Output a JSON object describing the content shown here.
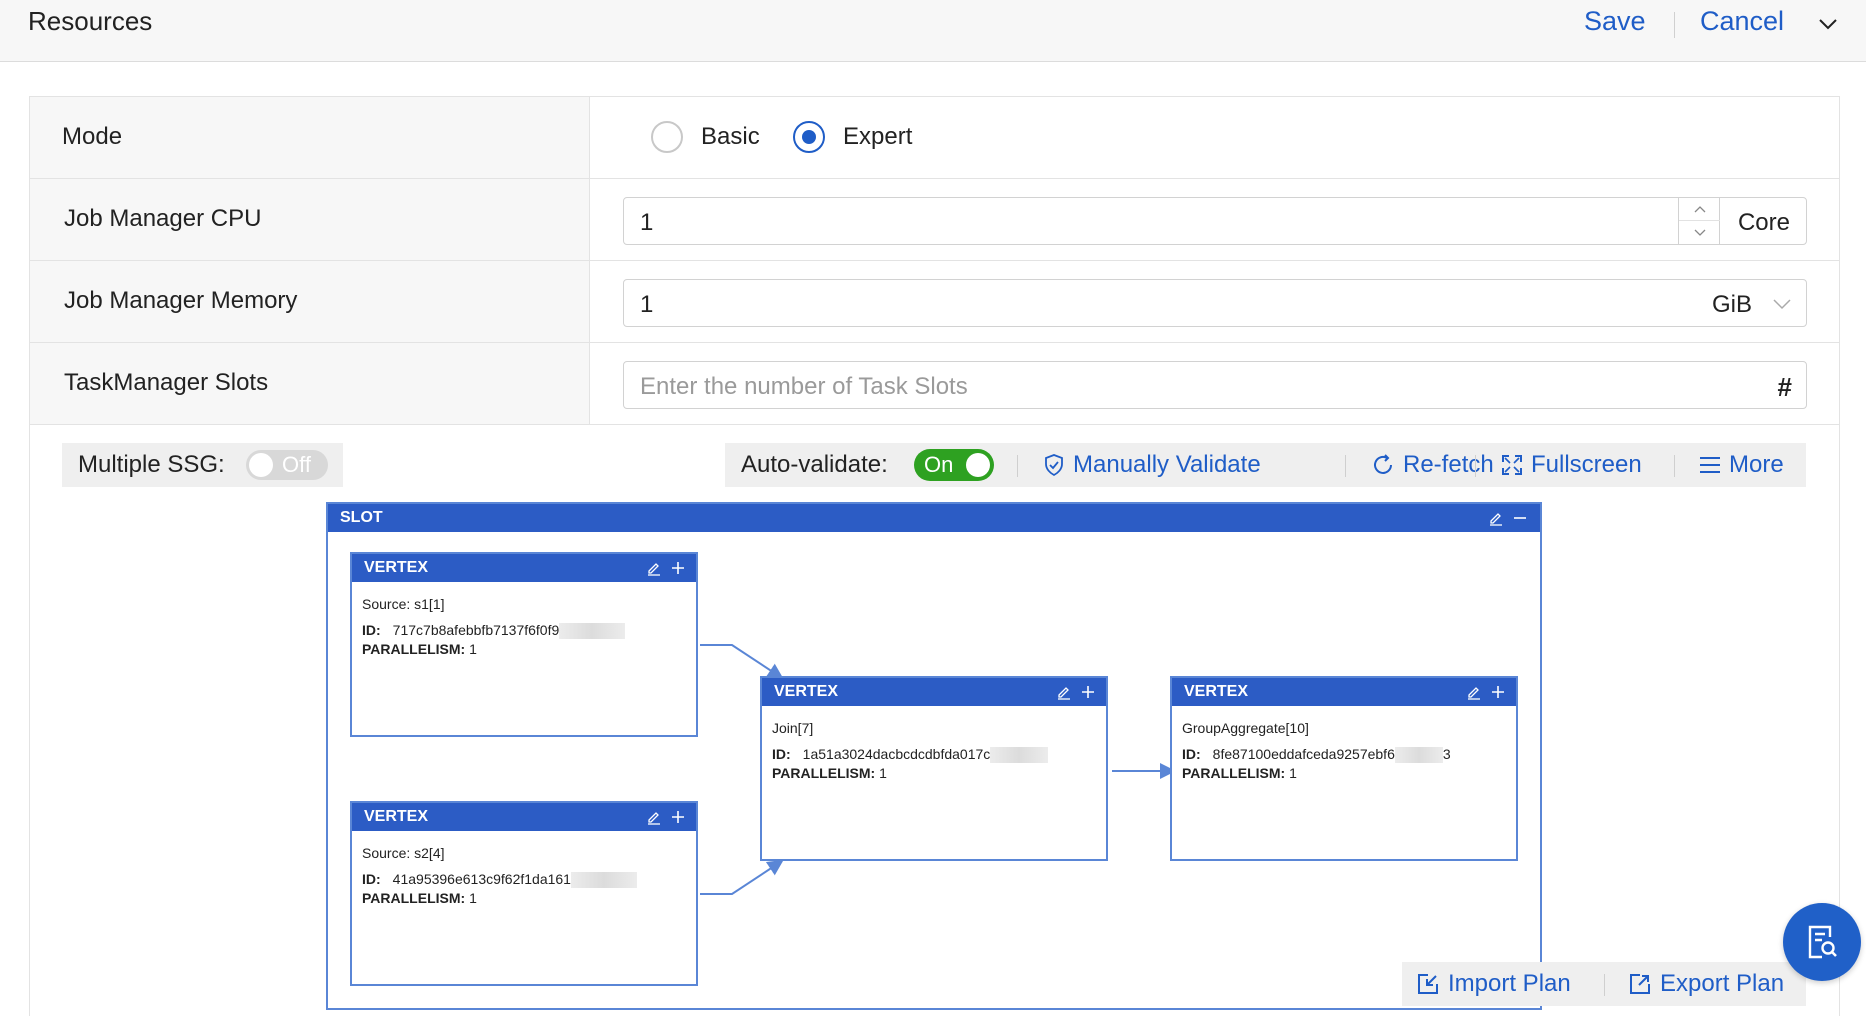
{
  "header": {
    "title": "Resources",
    "save_label": "Save",
    "cancel_label": "Cancel"
  },
  "form": {
    "mode": {
      "label": "Mode",
      "options": [
        "Basic",
        "Expert"
      ],
      "selected": "Expert"
    },
    "jm_cpu": {
      "label": "Job Manager CPU",
      "value": "1",
      "unit": "Core"
    },
    "jm_memory": {
      "label": "Job Manager Memory",
      "value": "1",
      "unit": "GiB"
    },
    "tm_slots": {
      "label": "TaskManager Slots",
      "placeholder": "Enter the number of Task Slots",
      "value": ""
    }
  },
  "toolbar": {
    "multiple_ssg_label": "Multiple SSG:",
    "multiple_ssg_state": "Off",
    "auto_validate_label": "Auto-validate:",
    "auto_validate_state": "On",
    "manually_validate": "Manually Validate",
    "refetch": "Re-fetch",
    "fullscreen": "Fullscreen",
    "more": "More"
  },
  "graph": {
    "slot_title": "SLOT",
    "vertices": [
      {
        "title": "VERTEX",
        "name": "Source: s1[1]",
        "id_label": "ID:",
        "id": "717c7b8afebbfb7137f6f0f9",
        "id_tail": "",
        "parallelism_label": "PARALLELISM:",
        "parallelism": "1"
      },
      {
        "title": "VERTEX",
        "name": "Source: s2[4]",
        "id_label": "ID:",
        "id": "41a95396e613c9f62f1da161",
        "id_tail": "",
        "parallelism_label": "PARALLELISM:",
        "parallelism": "1"
      },
      {
        "title": "VERTEX",
        "name": "Join[7]",
        "id_label": "ID:",
        "id": "1a51a3024dacbcdcdbfda017c",
        "id_tail": "",
        "parallelism_label": "PARALLELISM:",
        "parallelism": "1"
      },
      {
        "title": "VERTEX",
        "name": "GroupAggregate[10]",
        "id_label": "ID:",
        "id": "8fe87100eddafceda9257ebf6",
        "id_tail": "3",
        "parallelism_label": "PARALLELISM:",
        "parallelism": "1"
      }
    ]
  },
  "bottom": {
    "import_plan": "Import Plan",
    "export_plan": "Export Plan"
  },
  "colors": {
    "accent": "#1f5dc7",
    "header_blue": "#2c5cc5",
    "toggle_on": "#2ea121"
  },
  "icons": [
    "chevron-down-icon",
    "shield-check-icon",
    "refresh-icon",
    "fullscreen-icon",
    "menu-icon",
    "edit-icon",
    "plus-icon",
    "minus-icon",
    "import-icon",
    "export-icon",
    "search-doc-icon"
  ]
}
